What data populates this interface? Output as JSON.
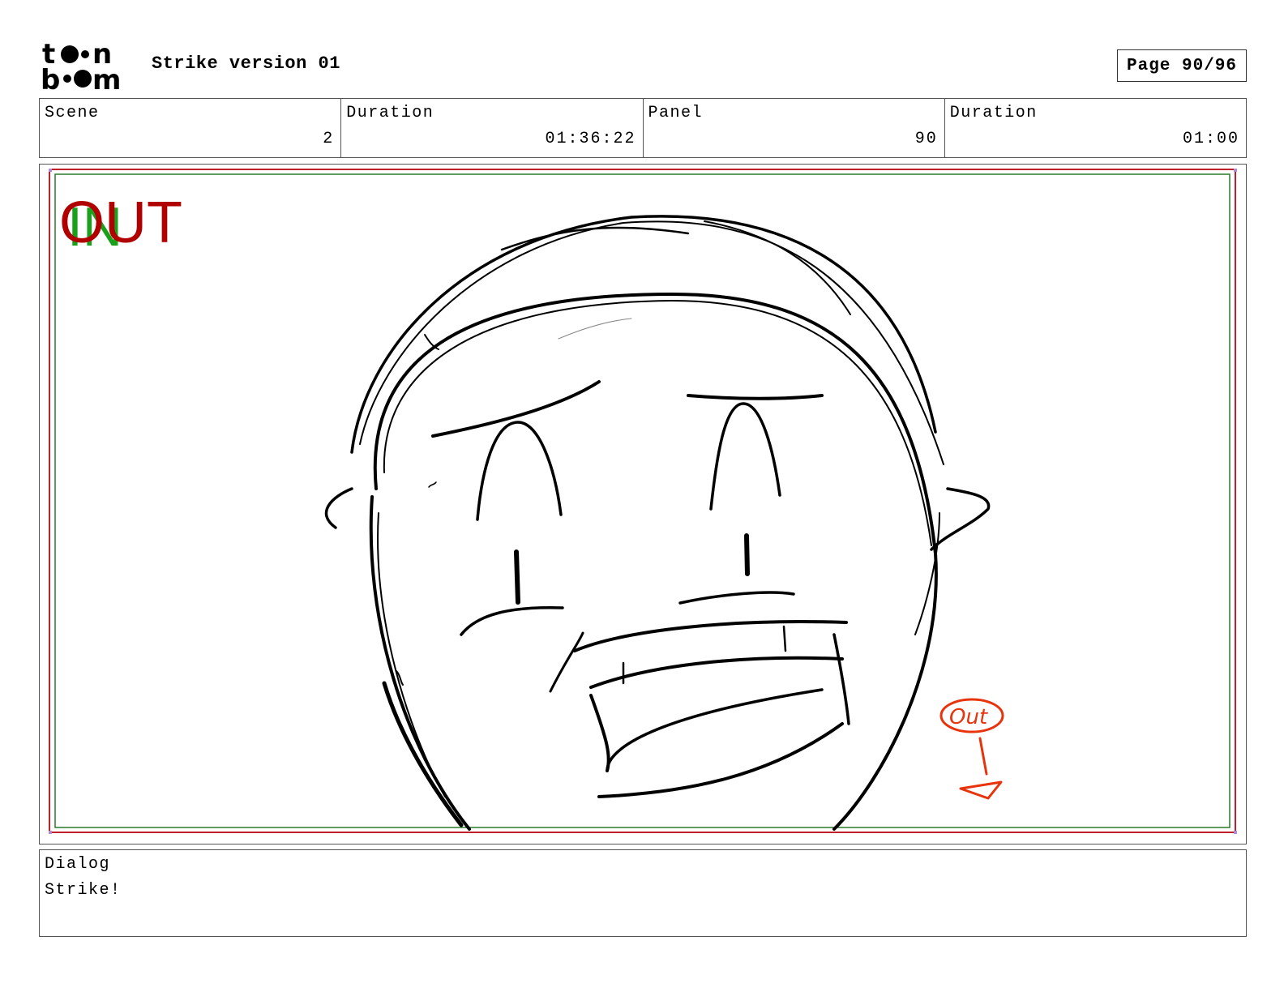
{
  "header": {
    "logo_text": "toon boom",
    "project_title": "Strike version 01",
    "page": "Page 90/96"
  },
  "info": {
    "scene_label": "Scene",
    "scene_value": "2",
    "scene_duration_label": "Duration",
    "scene_duration_value": "01:36:22",
    "panel_label": "Panel",
    "panel_value": "90",
    "panel_duration_label": "Duration",
    "panel_duration_value": "01:00"
  },
  "panel": {
    "in_marker": "IN",
    "out_marker": "OUT",
    "sketch_note": "Out",
    "colors": {
      "in_marker": "#1aa01a",
      "out_marker": "#b00000",
      "sketch_note": "#e8340c",
      "frame_outer": "#c0202a",
      "frame_inner": "#2a7a2a"
    }
  },
  "dialog": {
    "label": "Dialog",
    "text": "Strike!"
  }
}
